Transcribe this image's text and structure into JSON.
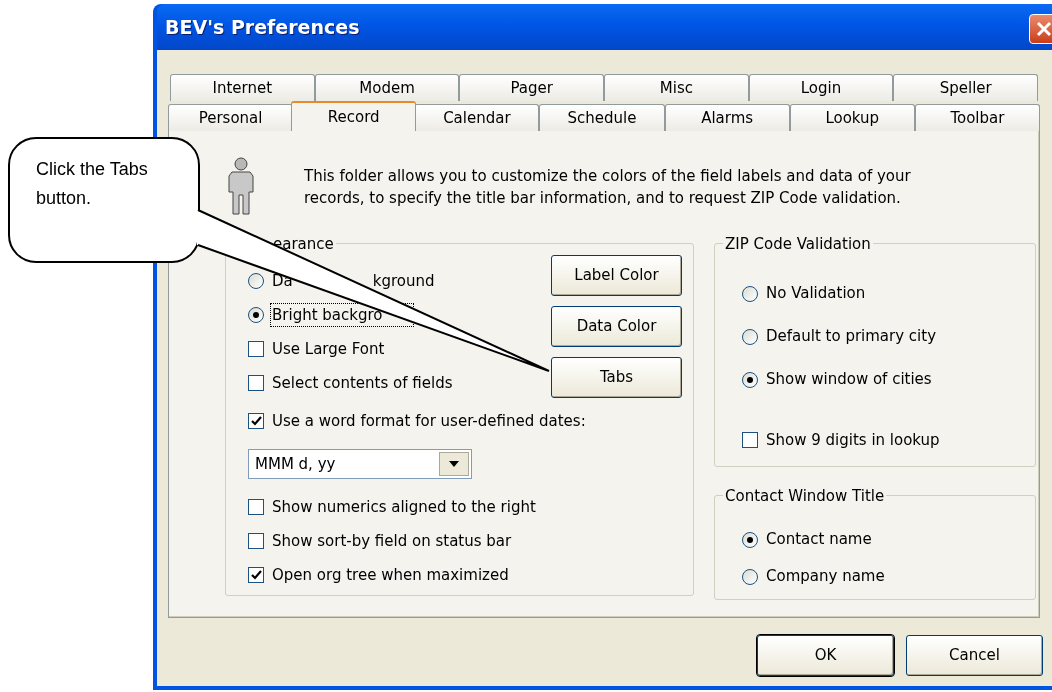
{
  "window": {
    "title": "BEV's Preferences"
  },
  "tab_rows": [
    [
      {
        "label": "Internet",
        "selected": false
      },
      {
        "label": "Modem",
        "selected": false
      },
      {
        "label": "Pager",
        "selected": false
      },
      {
        "label": "Misc",
        "selected": false
      },
      {
        "label": "Login",
        "selected": false
      },
      {
        "label": "Speller",
        "selected": false
      }
    ],
    [
      {
        "label": "Personal",
        "selected": false
      },
      {
        "label": "Record",
        "selected": true
      },
      {
        "label": "Calendar",
        "selected": false
      },
      {
        "label": "Schedule",
        "selected": false
      },
      {
        "label": "Alarms",
        "selected": false
      },
      {
        "label": "Lookup",
        "selected": false
      },
      {
        "label": "Toolbar",
        "selected": false
      }
    ]
  ],
  "intro_lines": [
    "This folder allows you to customize the colors of the field labels and data of your",
    "records, to specify the title bar information, and to request ZIP Code validation."
  ],
  "appearance": {
    "label": "earance",
    "options_top": [
      {
        "kind": "radio",
        "label_parts": [
          "Da",
          "kground"
        ],
        "selected": false,
        "focused": false
      },
      {
        "kind": "radio",
        "label_parts": [
          "Bright backgro"
        ],
        "selected": true,
        "focused": true
      },
      {
        "kind": "checkbox",
        "label": "Use Large Font",
        "checked": false
      },
      {
        "kind": "checkbox",
        "label": "Select contents of fields",
        "checked": false
      }
    ],
    "buttons": [
      {
        "label": "Label Color"
      },
      {
        "label": "Data Color"
      },
      {
        "label": "Tabs"
      }
    ],
    "options": [
      {
        "kind": "checkbox",
        "label": "Use a word format for user-defined dates:",
        "checked": true
      },
      {
        "kind": "dropdown",
        "value": "MMM d, yy"
      },
      {
        "kind": "checkbox",
        "label": "Show numerics aligned to the right",
        "checked": false
      },
      {
        "kind": "checkbox",
        "label": "Show sort-by field on status bar",
        "checked": false
      },
      {
        "kind": "checkbox",
        "label": "Open org tree when maximized",
        "checked": true
      }
    ]
  },
  "zip": {
    "label": "ZIP Code Validation",
    "options": [
      {
        "kind": "radio",
        "label": "No Validation",
        "selected": false
      },
      {
        "kind": "radio",
        "label": "Default to primary city",
        "selected": false
      },
      {
        "kind": "radio",
        "label": "Show window of cities",
        "selected": true
      },
      {
        "kind": "checkbox",
        "label": "Show 9 digits in lookup",
        "checked": false
      }
    ]
  },
  "contact": {
    "label": "Contact Window Title",
    "options": [
      {
        "kind": "radio",
        "label": "Contact name",
        "selected": true
      },
      {
        "kind": "radio",
        "label": "Company name",
        "selected": false
      }
    ]
  },
  "buttons": [
    {
      "label": "OK",
      "default": true
    },
    {
      "label": "Cancel",
      "default": false
    }
  ],
  "callout": {
    "text": "Click the Tabs button."
  }
}
